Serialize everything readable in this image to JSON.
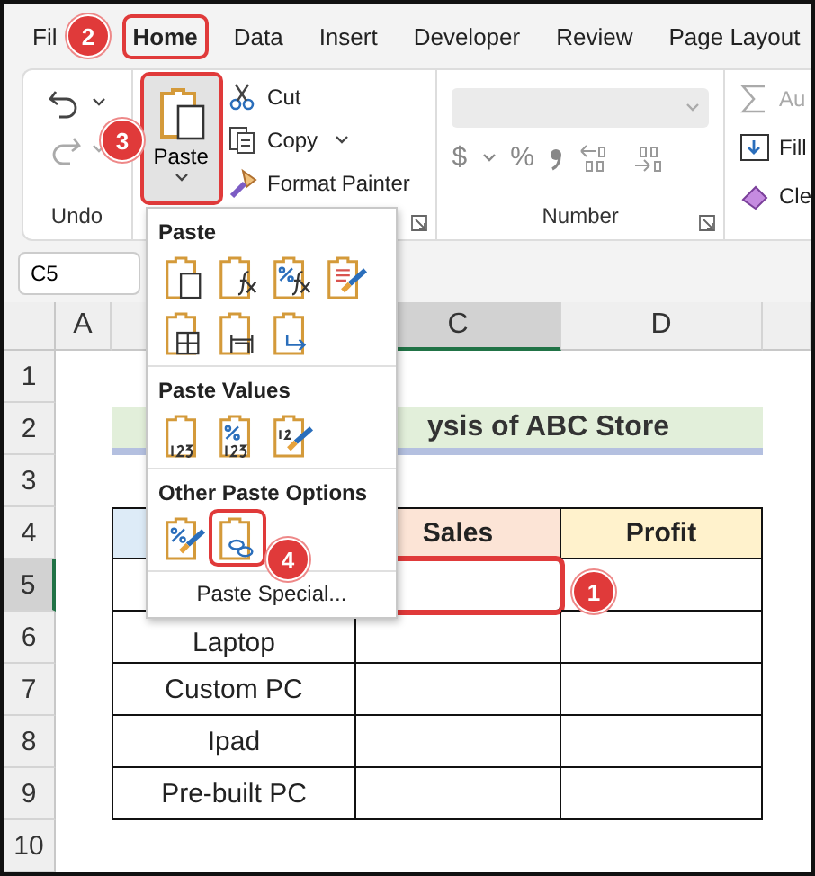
{
  "ribbon_tabs": [
    {
      "label": "Fil",
      "selected": false,
      "highlighted": false
    },
    {
      "label": "Home",
      "selected": true,
      "highlighted": true
    },
    {
      "label": "Data",
      "selected": false,
      "highlighted": false
    },
    {
      "label": "Insert",
      "selected": false,
      "highlighted": false
    },
    {
      "label": "Developer",
      "selected": false,
      "highlighted": false
    },
    {
      "label": "Review",
      "selected": false,
      "highlighted": false
    },
    {
      "label": "Page Layout",
      "selected": false,
      "highlighted": false
    }
  ],
  "undo_group": {
    "label": "Undo",
    "commands": [
      {
        "kind": "undo",
        "disabled": false
      },
      {
        "kind": "redo",
        "disabled": true
      }
    ]
  },
  "clipboard_group": {
    "paste_button": {
      "label": "Paste",
      "highlighted": true
    },
    "commands": [
      {
        "kind": "cut",
        "label": "Cut"
      },
      {
        "kind": "copy",
        "label": "Copy"
      },
      {
        "kind": "painter",
        "label": "Format Painter"
      }
    ]
  },
  "number_group": {
    "label": "Number",
    "currency": "$",
    "percent": "%"
  },
  "editing_group": {
    "commands": [
      {
        "kind": "autosum",
        "label": "Au",
        "disabled": true
      },
      {
        "kind": "fill",
        "label": "Fill",
        "disabled": false
      },
      {
        "kind": "clear",
        "label": "Cle",
        "disabled": false
      }
    ]
  },
  "name_box": {
    "value": "C5"
  },
  "column_headers": [
    {
      "label": "A",
      "selected": false
    },
    {
      "label": "C",
      "selected": true
    },
    {
      "label": "D",
      "selected": false
    }
  ],
  "row_headers": [
    {
      "label": "1",
      "selected": false
    },
    {
      "label": "2",
      "selected": false
    },
    {
      "label": "3",
      "selected": false
    },
    {
      "label": "4",
      "selected": false
    },
    {
      "label": "5",
      "selected": true
    },
    {
      "label": "6",
      "selected": false
    },
    {
      "label": "7",
      "selected": false
    },
    {
      "label": "8",
      "selected": false
    },
    {
      "label": "9",
      "selected": false
    },
    {
      "label": "10",
      "selected": false
    }
  ],
  "sheet": {
    "title": "ysis of ABC Store",
    "headings": [
      "Sales",
      "Profit"
    ],
    "rows": [
      "Laptop",
      "Custom PC",
      "Ipad",
      "Pre-built PC"
    ],
    "active_cell": {
      "highlighted": true
    }
  },
  "paste_menu": {
    "sections": [
      {
        "heading": "Paste",
        "options": [
          {
            "kind": "paste",
            "highlighted": false
          },
          {
            "kind": "formulas",
            "highlighted": false
          },
          {
            "kind": "formulas-format",
            "highlighted": false
          },
          {
            "kind": "keep-source",
            "highlighted": false
          },
          {
            "kind": "no-borders",
            "highlighted": false
          },
          {
            "kind": "column-widths",
            "highlighted": false
          },
          {
            "kind": "transpose",
            "highlighted": false
          }
        ]
      },
      {
        "heading": "Paste Values",
        "options": [
          {
            "kind": "values",
            "highlighted": false
          },
          {
            "kind": "values-format",
            "highlighted": false
          },
          {
            "kind": "values-source",
            "highlighted": false
          }
        ]
      },
      {
        "heading": "Other Paste Options",
        "options": [
          {
            "kind": "formatting",
            "highlighted": false
          },
          {
            "kind": "link",
            "highlighted": true
          }
        ]
      }
    ],
    "footer": "Paste Special..."
  },
  "step_badges": [
    "1",
    "2",
    "3",
    "4"
  ]
}
